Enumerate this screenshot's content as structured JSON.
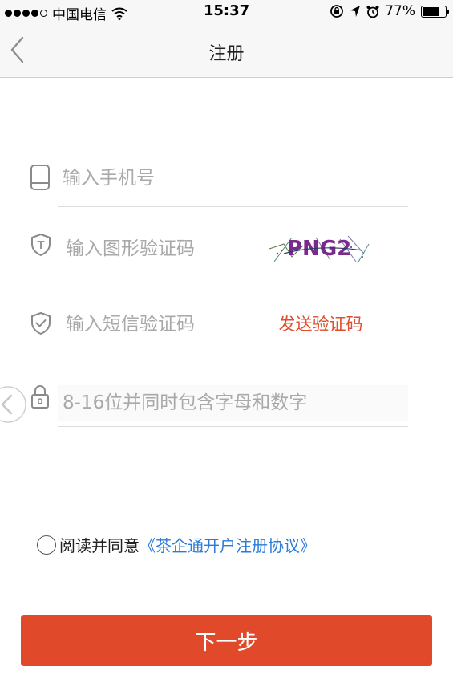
{
  "status_bar": {
    "carrier": "中国电信",
    "time": "15:37",
    "battery": "77%",
    "battery_level": 0.77
  },
  "nav": {
    "title": "注册",
    "back_icon": "chevron-left-icon"
  },
  "form": {
    "phone_placeholder": "输入手机号",
    "captcha_placeholder": "输入图形验证码",
    "captcha_image_text": "PNG2",
    "sms_placeholder": "输入短信验证码",
    "send_code_label": "发送验证码",
    "password_placeholder": "8-16位并同时包含字母和数字"
  },
  "agreement": {
    "prefix": "阅读并同意",
    "link": "《茶企通开户注册协议》",
    "checked": false
  },
  "next_button_label": "下一步",
  "colors": {
    "accent": "#e04a2a",
    "link": "#2b7bd8",
    "placeholder": "#a9a9a9",
    "divider": "#dcdcdc"
  }
}
